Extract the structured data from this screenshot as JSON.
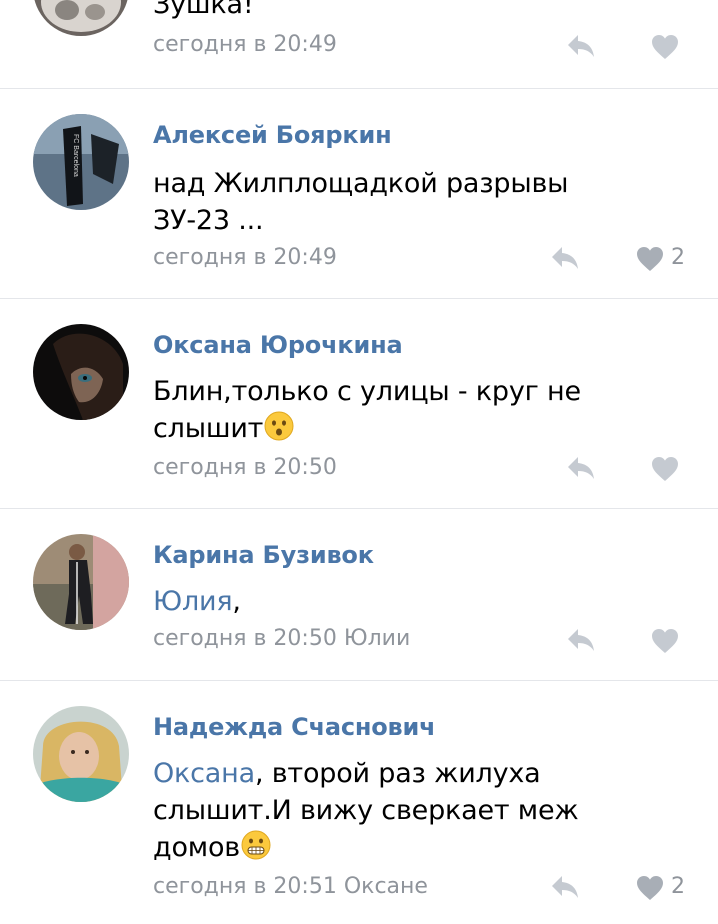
{
  "comments": [
    {
      "text_tail": "Зушка!",
      "time": "сегодня в 20:49",
      "likes": ""
    },
    {
      "author": "Алексей Бояркин",
      "text": "над Жилплощадкой разрывы ЗУ-23 ...",
      "time": "сегодня в 20:49",
      "likes": "2",
      "avatar_text": "FC Barcelona"
    },
    {
      "author": "Оксана Юрочкина",
      "text": "Блин,только с улицы - круг не слышит",
      "time": "сегодня в 20:50",
      "likes": ""
    },
    {
      "author": "Карина Бузивок",
      "mention": "Юлия",
      "text": ",",
      "time": "сегодня в 20:50",
      "reply_to": "Юлии",
      "likes": ""
    },
    {
      "author": "Надежда Счаснович",
      "mention": "Оксана",
      "text": ", второй раз жилуха слышит.И вижу сверкает меж домов",
      "time": "сегодня в 20:51",
      "reply_to": "Оксане",
      "likes": "2"
    }
  ],
  "icons": {
    "reply": "reply-arrow-icon",
    "like": "heart-icon"
  },
  "colors": {
    "link": "#4a76a8",
    "meta": "#8f949b",
    "icon": "#c5cad1",
    "divider": "#e4e6ea"
  }
}
